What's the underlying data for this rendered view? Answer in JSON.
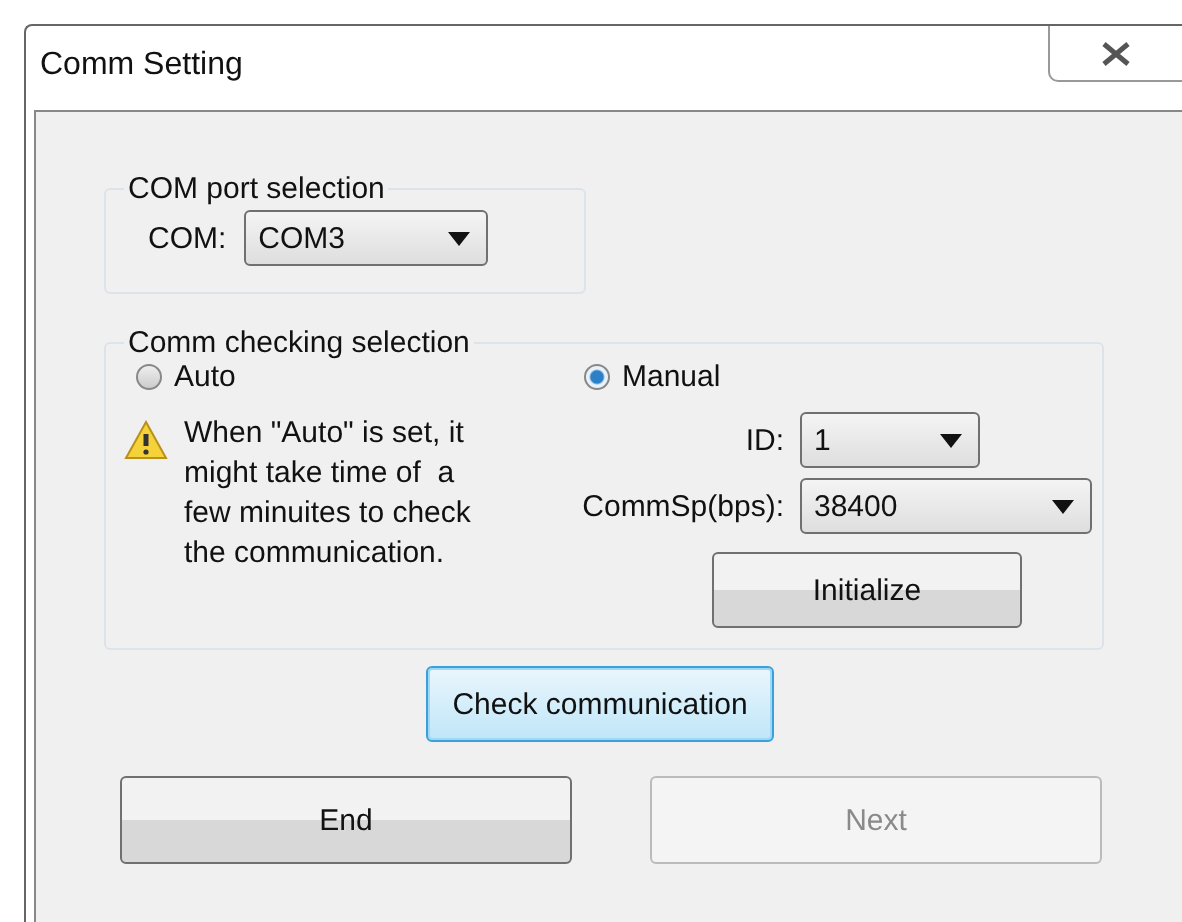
{
  "window": {
    "title": "Comm Setting"
  },
  "com_group": {
    "title": "COM port selection",
    "label": "COM:",
    "value": "COM3"
  },
  "check_group": {
    "title": "Comm checking selection",
    "modes": [
      {
        "label": "Auto",
        "selected": false
      },
      {
        "label": "Manual",
        "selected": true
      }
    ],
    "warning": "When \"Auto\" is set, it might take time of  a few minuites to check the communication.",
    "fields": [
      {
        "label": "ID:",
        "value": "1"
      },
      {
        "label": "CommSp(bps):",
        "value": "38400"
      }
    ],
    "initialize_button": "Initialize"
  },
  "check_button": {
    "label": "Check communication",
    "focused": true
  },
  "buttons": [
    {
      "label": "End",
      "disabled": false
    },
    {
      "label": "Next",
      "disabled": true
    }
  ]
}
